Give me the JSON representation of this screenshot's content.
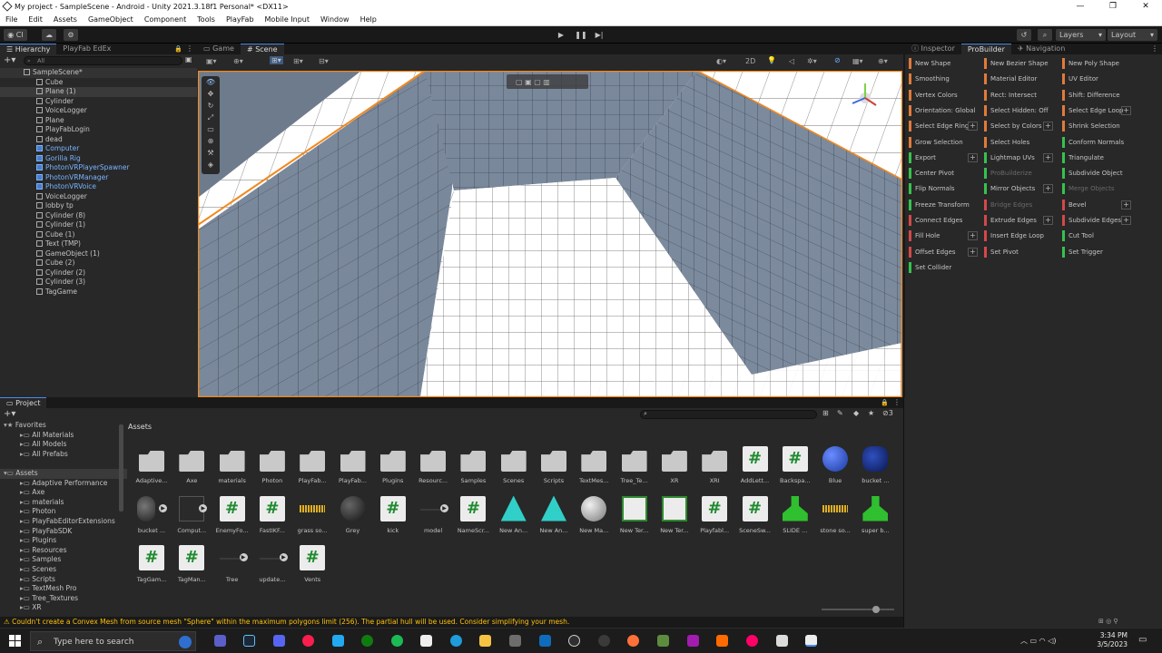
{
  "window": {
    "title": "My project - SampleScene - Android - Unity 2021.3.18f1 Personal* <DX11>",
    "minimize": "—",
    "maximize": "❐",
    "close": "✕"
  },
  "menu": [
    "File",
    "Edit",
    "Assets",
    "GameObject",
    "Component",
    "Tools",
    "PlayFab",
    "Mobile Input",
    "Window",
    "Help"
  ],
  "toolbar": {
    "layers": "Layers",
    "layout": "Layout",
    "account_short": "CI"
  },
  "hierarchy": {
    "tabs": [
      "Hierarchy",
      "PlayFab EdEx"
    ],
    "search_placeholder": "All",
    "items": [
      {
        "label": "SampleScene*",
        "depth": 0,
        "style": "scene"
      },
      {
        "label": "Cube",
        "depth": 1
      },
      {
        "label": "Plane (1)",
        "depth": 1
      },
      {
        "label": "Cylinder",
        "depth": 1
      },
      {
        "label": "VoiceLogger",
        "depth": 1
      },
      {
        "label": "Plane",
        "depth": 1
      },
      {
        "label": "PlayFabLogin",
        "depth": 1
      },
      {
        "label": "dead",
        "depth": 1
      },
      {
        "label": "Computer",
        "depth": 1,
        "style": "blue"
      },
      {
        "label": "Gorilla Rig",
        "depth": 1,
        "style": "blue"
      },
      {
        "label": "PhotonVRPlayerSpawner",
        "depth": 1,
        "style": "blue"
      },
      {
        "label": "PhotonVRManager",
        "depth": 1,
        "style": "blue"
      },
      {
        "label": "PhotonVRVoice",
        "depth": 1,
        "style": "blue"
      },
      {
        "label": "VoiceLogger",
        "depth": 1
      },
      {
        "label": "lobby tp",
        "depth": 1
      },
      {
        "label": "Cylinder (8)",
        "depth": 1
      },
      {
        "label": "Cylinder (1)",
        "depth": 1
      },
      {
        "label": "Cube (1)",
        "depth": 1
      },
      {
        "label": "Text (TMP)",
        "depth": 1
      },
      {
        "label": "GameObject (1)",
        "depth": 1
      },
      {
        "label": "Cube (2)",
        "depth": 1
      },
      {
        "label": "Cylinder (2)",
        "depth": 1
      },
      {
        "label": "Cylinder (3)",
        "depth": 1
      },
      {
        "label": "TagGame",
        "depth": 1
      }
    ]
  },
  "scene": {
    "tabs": [
      "Game",
      "Scene"
    ],
    "mode_2d": "2D",
    "persp": "< Persp"
  },
  "inspector": {
    "tabs": [
      "Inspector",
      "ProBuilder",
      "Navigation"
    ],
    "buttons": [
      {
        "label": "New Shape",
        "col": 0,
        "row": 0,
        "color": "orange"
      },
      {
        "label": "New Bezier Shape",
        "col": 1,
        "row": 0,
        "color": "orange"
      },
      {
        "label": "New Poly Shape",
        "col": 2,
        "row": 0,
        "color": "orange"
      },
      {
        "label": "Smoothing",
        "col": 0,
        "row": 1,
        "color": "orange"
      },
      {
        "label": "Material Editor",
        "col": 1,
        "row": 1,
        "color": "orange"
      },
      {
        "label": "UV Editor",
        "col": 2,
        "row": 1,
        "color": "orange"
      },
      {
        "label": "Vertex Colors",
        "col": 0,
        "row": 2,
        "color": "orange"
      },
      {
        "label": "Rect: Intersect",
        "col": 1,
        "row": 2,
        "color": "orange"
      },
      {
        "label": "Shift: Difference",
        "col": 2,
        "row": 2,
        "color": "orange"
      },
      {
        "label": "Orientation: Global",
        "col": 0,
        "row": 3,
        "color": "orange"
      },
      {
        "label": "Select Hidden: Off",
        "col": 1,
        "row": 3,
        "color": "orange"
      },
      {
        "label": "Select Edge Loop",
        "col": 2,
        "row": 3,
        "color": "orange",
        "plus": true
      },
      {
        "label": "Select Edge Ring",
        "col": 0,
        "row": 4,
        "color": "orange",
        "plus": true
      },
      {
        "label": "Select by Colors",
        "col": 1,
        "row": 4,
        "color": "orange",
        "plus": true
      },
      {
        "label": "Shrink Selection",
        "col": 2,
        "row": 4,
        "color": "orange"
      },
      {
        "label": "Grow Selection",
        "col": 0,
        "row": 5,
        "color": "orange"
      },
      {
        "label": "Select Holes",
        "col": 1,
        "row": 5,
        "color": "orange"
      },
      {
        "label": "Conform Normals",
        "col": 2,
        "row": 5,
        "color": "green"
      },
      {
        "label": "Export",
        "col": 0,
        "row": 6,
        "color": "green",
        "plus": true
      },
      {
        "label": "Lightmap UVs",
        "col": 1,
        "row": 6,
        "color": "green",
        "plus": true
      },
      {
        "label": "Triangulate",
        "col": 2,
        "row": 6,
        "color": "green"
      },
      {
        "label": "Center Pivot",
        "col": 0,
        "row": 7,
        "color": "green"
      },
      {
        "label": "ProBuilderize",
        "col": 1,
        "row": 7,
        "color": "green",
        "dim": true
      },
      {
        "label": "Subdivide Object",
        "col": 2,
        "row": 7,
        "color": "green"
      },
      {
        "label": "Flip Normals",
        "col": 0,
        "row": 8,
        "color": "green"
      },
      {
        "label": "Mirror Objects",
        "col": 1,
        "row": 8,
        "color": "green",
        "plus": true
      },
      {
        "label": "Merge Objects",
        "col": 2,
        "row": 8,
        "color": "green",
        "dim": true
      },
      {
        "label": "Freeze Transform",
        "col": 0,
        "row": 9,
        "color": "green"
      },
      {
        "label": "Bridge Edges",
        "col": 1,
        "row": 9,
        "color": "red",
        "dim": true
      },
      {
        "label": "Bevel",
        "col": 2,
        "row": 9,
        "color": "red",
        "plus": true
      },
      {
        "label": "Connect Edges",
        "col": 0,
        "row": 10,
        "color": "red"
      },
      {
        "label": "Extrude Edges",
        "col": 1,
        "row": 10,
        "color": "red",
        "plus": true
      },
      {
        "label": "Subdivide Edges",
        "col": 2,
        "row": 10,
        "color": "red",
        "plus": true
      },
      {
        "label": "Fill Hole",
        "col": 0,
        "row": 11,
        "color": "red",
        "plus": true
      },
      {
        "label": "Insert Edge Loop",
        "col": 1,
        "row": 11,
        "color": "red"
      },
      {
        "label": "Cut Tool",
        "col": 2,
        "row": 11,
        "color": "green"
      },
      {
        "label": "Offset Edges",
        "col": 0,
        "row": 12,
        "color": "red",
        "plus": true
      },
      {
        "label": "Set Pivot",
        "col": 1,
        "row": 12,
        "color": "red"
      },
      {
        "label": "Set Trigger",
        "col": 2,
        "row": 12,
        "color": "green"
      },
      {
        "label": "Set Collider",
        "col": 0,
        "row": 13,
        "color": "green"
      }
    ]
  },
  "project": {
    "tab": "Project",
    "breadcrumb": "Assets",
    "hidden_count": "3",
    "tree": [
      {
        "label": "Favorites",
        "depth": 0,
        "star": true
      },
      {
        "label": "All Materials",
        "depth": 1
      },
      {
        "label": "All Models",
        "depth": 1
      },
      {
        "label": "All Prefabs",
        "depth": 1
      },
      {
        "label": "",
        "depth": 1
      },
      {
        "label": "Assets",
        "depth": 0
      },
      {
        "label": "Adaptive Performance",
        "depth": 1
      },
      {
        "label": "Axe",
        "depth": 1
      },
      {
        "label": "materials",
        "depth": 1
      },
      {
        "label": "Photon",
        "depth": 1
      },
      {
        "label": "PlayFabEditorExtensions",
        "depth": 1
      },
      {
        "label": "PlayFabSDK",
        "depth": 1
      },
      {
        "label": "Plugins",
        "depth": 1
      },
      {
        "label": "Resources",
        "depth": 1
      },
      {
        "label": "Samples",
        "depth": 1
      },
      {
        "label": "Scenes",
        "depth": 1
      },
      {
        "label": "Scripts",
        "depth": 1
      },
      {
        "label": "TextMesh Pro",
        "depth": 1
      },
      {
        "label": "Tree_Textures",
        "depth": 1
      },
      {
        "label": "XR",
        "depth": 1
      }
    ],
    "assets": [
      {
        "label": "Adaptive...",
        "kind": "folder"
      },
      {
        "label": "Axe",
        "kind": "folder"
      },
      {
        "label": "materials",
        "kind": "folder"
      },
      {
        "label": "Photon",
        "kind": "folder"
      },
      {
        "label": "PlayFab...",
        "kind": "folder"
      },
      {
        "label": "PlayFab...",
        "kind": "folder"
      },
      {
        "label": "Plugins",
        "kind": "folder"
      },
      {
        "label": "Resourc...",
        "kind": "folder"
      },
      {
        "label": "Samples",
        "kind": "folder"
      },
      {
        "label": "Scenes",
        "kind": "folder"
      },
      {
        "label": "Scripts",
        "kind": "folder"
      },
      {
        "label": "TextMes...",
        "kind": "folder"
      },
      {
        "label": "Tree_Te...",
        "kind": "folder"
      },
      {
        "label": "XR",
        "kind": "folder"
      },
      {
        "label": "XRI",
        "kind": "folder"
      },
      {
        "label": "AddLett...",
        "kind": "script"
      },
      {
        "label": "Backspa...",
        "kind": "script"
      },
      {
        "label": "Blue",
        "kind": "sphere-blue"
      },
      {
        "label": "bucket ...",
        "kind": "bucket"
      },
      {
        "label": "bucket ...",
        "kind": "model"
      },
      {
        "label": "Comput...",
        "kind": "model-dark"
      },
      {
        "label": "EnemyFo...",
        "kind": "script"
      },
      {
        "label": "FastIKF...",
        "kind": "script"
      },
      {
        "label": "grass so...",
        "kind": "audio"
      },
      {
        "label": "Grey",
        "kind": "sphere-dark"
      },
      {
        "label": "kick",
        "kind": "script"
      },
      {
        "label": "model",
        "kind": "model-flat"
      },
      {
        "label": "NameScr...",
        "kind": "script"
      },
      {
        "label": "New An...",
        "kind": "anim"
      },
      {
        "label": "New An...",
        "kind": "anim"
      },
      {
        "label": "New Ma...",
        "kind": "sphere-grey"
      },
      {
        "label": "New Ter...",
        "kind": "terrain"
      },
      {
        "label": "New Ter...",
        "kind": "terrain"
      },
      {
        "label": "Playfabl...",
        "kind": "script"
      },
      {
        "label": "SceneSw...",
        "kind": "script"
      },
      {
        "label": "SLIDE ...",
        "kind": "prefab-green"
      },
      {
        "label": "stone so...",
        "kind": "audio"
      },
      {
        "label": "super b...",
        "kind": "prefab-green"
      },
      {
        "label": "TagGam...",
        "kind": "script"
      },
      {
        "label": "TagMan...",
        "kind": "script"
      },
      {
        "label": "Tree",
        "kind": "model-flat"
      },
      {
        "label": "update...",
        "kind": "model-flat"
      },
      {
        "label": "Vents",
        "kind": "script"
      }
    ]
  },
  "status": {
    "message": "Couldn't create a Convex Mesh from source mesh \"Sphere\" within the maximum polygons limit (256). The partial hull will be used. Consider simplifying your mesh."
  },
  "taskbar": {
    "search_placeholder": "Type here to search",
    "time": "3:34 PM",
    "date": "3/5/2023"
  },
  "colors": {
    "accent": "#4a8cf0",
    "warning": "#ffc107",
    "script_green": "#1e8a2e"
  }
}
